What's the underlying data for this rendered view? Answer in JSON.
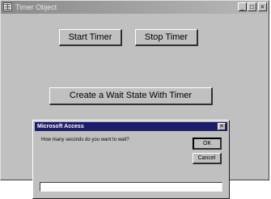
{
  "window": {
    "title": "Timer Object",
    "minimize_glyph": "_",
    "maximize_glyph": "□",
    "close_glyph": "×"
  },
  "buttons": {
    "start_timer": "Start Timer",
    "stop_timer": "Stop Timer",
    "wait_state": "Create a Wait State With Timer"
  },
  "dialog": {
    "title": "Microsoft Access",
    "close_glyph": "✕",
    "prompt": "How many seconds do you want to wait?",
    "ok_label": "OK",
    "cancel_label": "Cancel",
    "input_value": ""
  }
}
